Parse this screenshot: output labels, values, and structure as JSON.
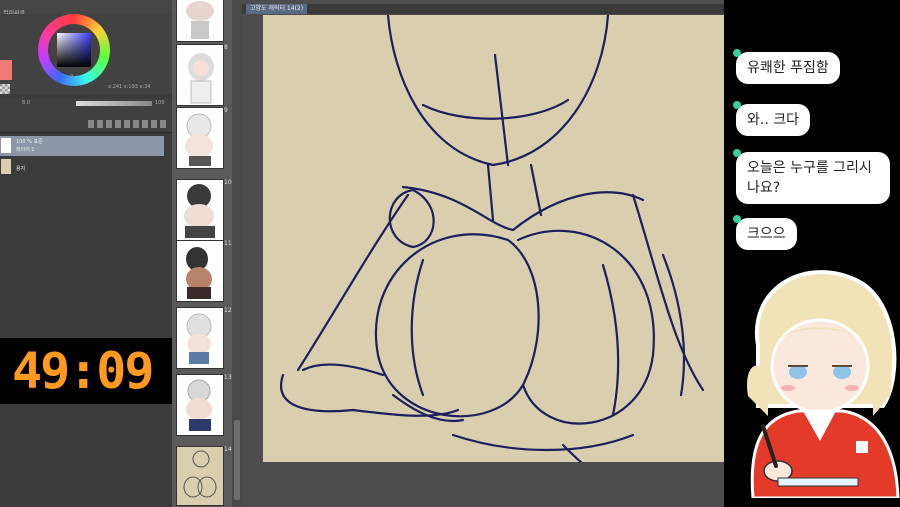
{
  "left_panel": {
    "top_label": "컬러써클",
    "wheel_value": "0",
    "readout": "x:241 x:193 x:34",
    "brush_size": "8.0",
    "opacity_value": "100",
    "layers": [
      {
        "label": "100 % 표준",
        "sub": "레이어 1",
        "active": true
      },
      {
        "label": "용지",
        "sub": "",
        "active": false
      }
    ]
  },
  "timer": {
    "value": "49:09"
  },
  "thumbnails": {
    "numbers": [
      "8",
      "9",
      "10",
      "11",
      "12",
      "13",
      "14"
    ]
  },
  "canvas": {
    "tab_label": "고양도 캐릭터 14(2)",
    "paper_color": "#d9cfae",
    "stroke_color": "#1c1f5e"
  },
  "chat": {
    "messages": [
      "유쾌한 푸짐함",
      "와.. 크다",
      "오늘은 누구를 그리시나요?",
      "크으으"
    ],
    "accent_color": "#32d29a"
  }
}
